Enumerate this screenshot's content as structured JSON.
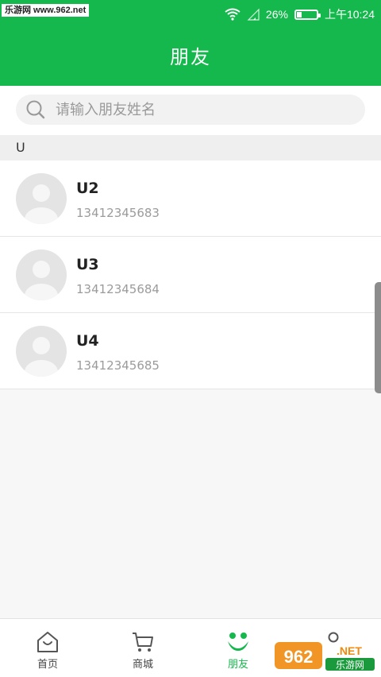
{
  "watermark_top": "乐游网 www.962.net",
  "status": {
    "battery": "26%",
    "time": "上午10:24",
    "battery_level": 0.26
  },
  "header": {
    "title": "朋友"
  },
  "search": {
    "placeholder": "请输入朋友姓名",
    "value": ""
  },
  "section": "U",
  "contacts": [
    {
      "name": "U2",
      "phone": "13412345683"
    },
    {
      "name": "U3",
      "phone": "13412345684"
    },
    {
      "name": "U4",
      "phone": "13412345685"
    }
  ],
  "tabs": [
    {
      "label": "首页",
      "icon": "home-icon",
      "active": false
    },
    {
      "label": "商城",
      "icon": "cart-icon",
      "active": false
    },
    {
      "label": "朋友",
      "icon": "friends-icon",
      "active": true
    },
    {
      "label": "",
      "icon": "profile-icon",
      "active": false
    }
  ],
  "brand_watermark": {
    "text": "962.NET 乐游网"
  },
  "colors": {
    "primary": "#15b84d",
    "brand_orange": "#f08a10"
  }
}
